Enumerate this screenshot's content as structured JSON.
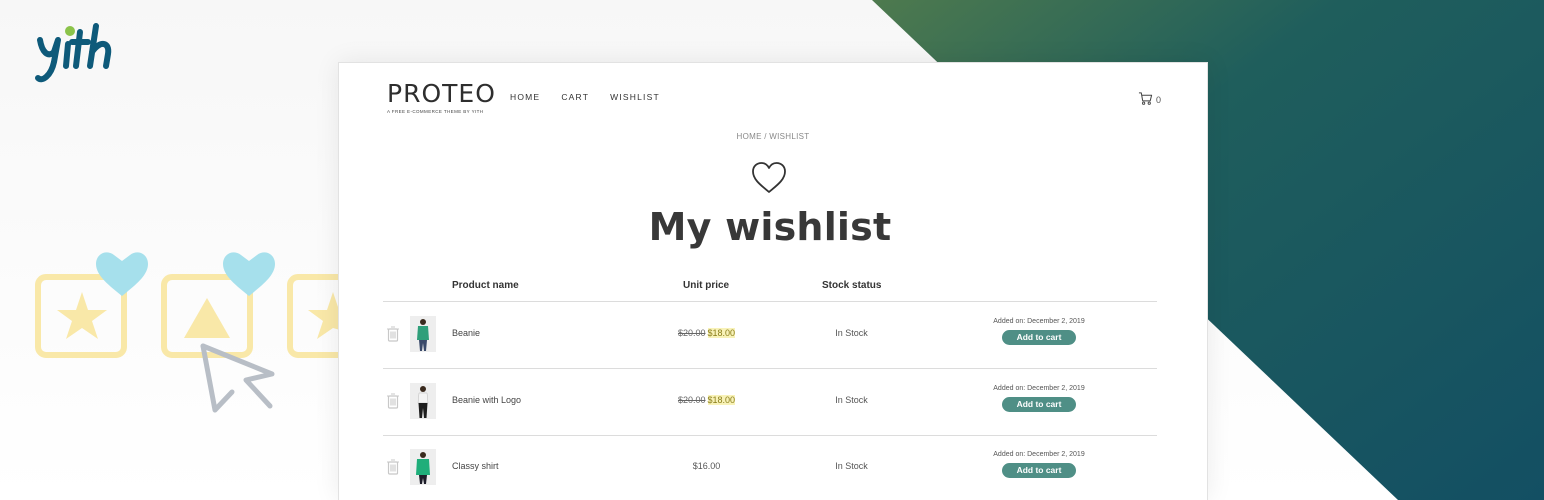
{
  "brand": {
    "name": "PROTEO",
    "tagline": "A FREE E-COMMERCE THEME BY YITH"
  },
  "nav": [
    "HOME",
    "CART",
    "WISHLIST"
  ],
  "cart": {
    "count": "0",
    "icon": "cart-icon"
  },
  "breadcrumb": "HOME / WISHLIST",
  "page_title": "My wishlist",
  "columns": {
    "name": "Product name",
    "price": "Unit price",
    "stock": "Stock status"
  },
  "rows": [
    {
      "name": "Beanie",
      "old_price": "$20.00",
      "price": "$18.00",
      "stock": "In Stock",
      "added": "Added on: December 2, 2019",
      "button": "Add to cart",
      "thumb": "green-top"
    },
    {
      "name": "Beanie with Logo",
      "old_price": "$20.00",
      "price": "$18.00",
      "stock": "In Stock",
      "added": "Added on: December 2, 2019",
      "button": "Add to cart",
      "thumb": "white-top"
    },
    {
      "name": "Classy shirt",
      "old_price": "",
      "price": "$16.00",
      "stock": "In Stock",
      "added": "Added on: December 2, 2019",
      "button": "Add to cart",
      "thumb": "green-shirt"
    }
  ],
  "colors": {
    "accent": "#4f8f86",
    "teal_bg": "#17606a",
    "sale_highlight": "#f8f2b8",
    "heart_deco": "#a6e0ec",
    "star_deco": "#f9e8a8"
  }
}
